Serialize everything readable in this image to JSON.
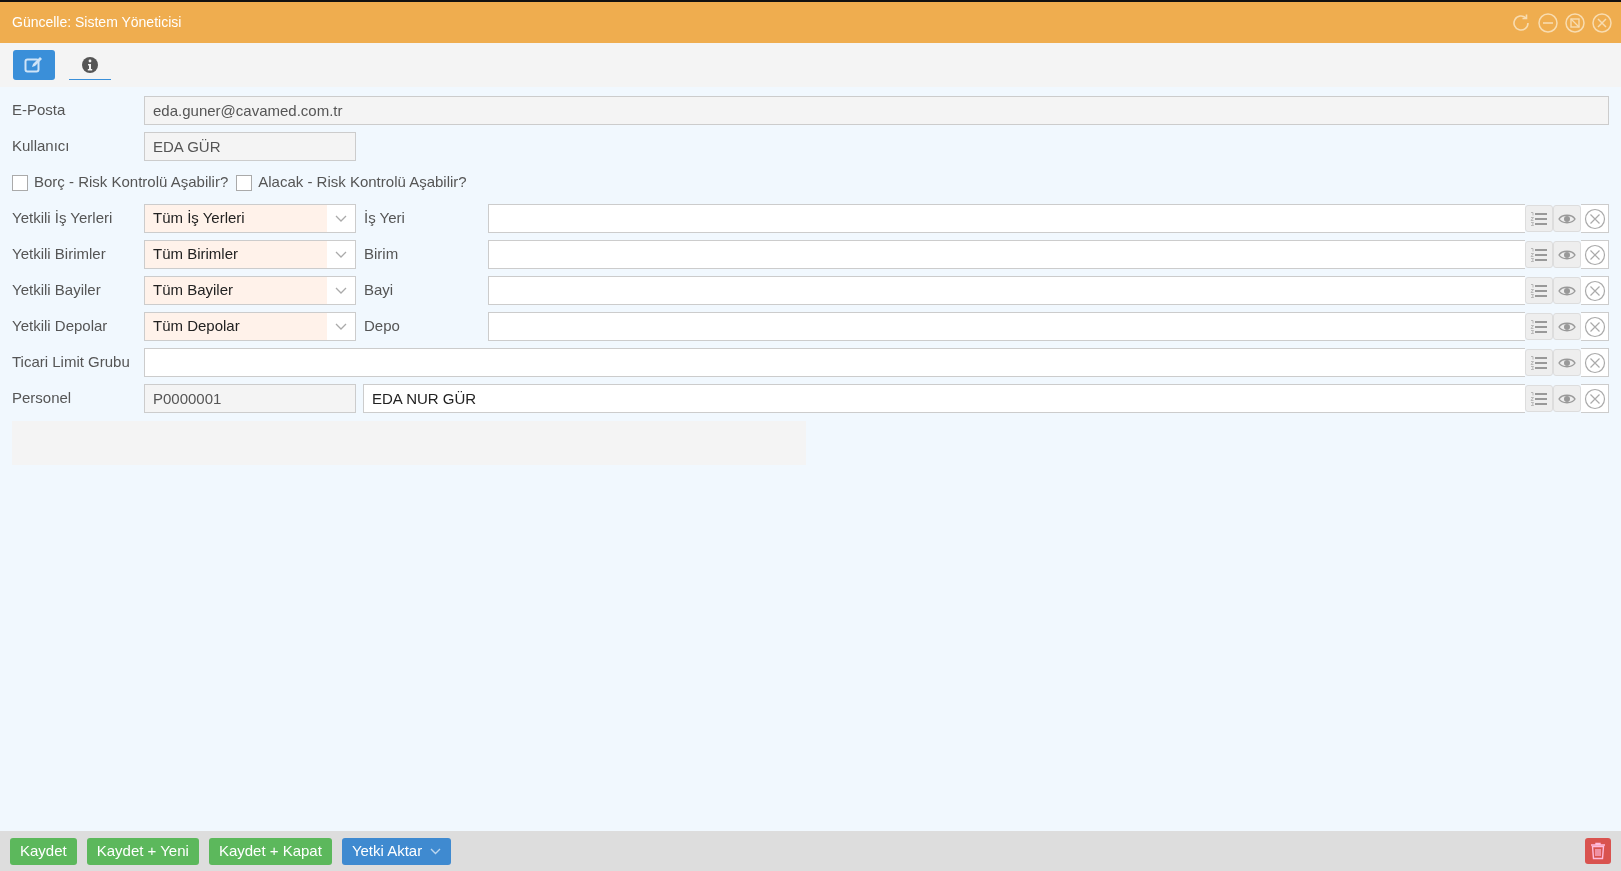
{
  "window": {
    "title": "Güncelle: Sistem Yöneticisi"
  },
  "tabs": [
    {
      "kind": "edit",
      "selected": true
    },
    {
      "kind": "info",
      "selected": false
    }
  ],
  "form_rows": [
    {
      "kind": "wide_text",
      "label": "E-Posta",
      "value": "eda.guner@cavamed.com.tr"
    },
    {
      "kind": "short_text",
      "label": "Kullanıcı",
      "value": "EDA GÜR"
    },
    {
      "kind": "checkboxes",
      "items": [
        {
          "label": "Borç - Risk Kontrolü Aşabilir?",
          "checked": false
        },
        {
          "label": "Alacak - Risk Kontrolü Aşabilir?",
          "checked": false
        }
      ]
    },
    {
      "kind": "dropdown_lookup",
      "label": "Yetkili İş Yerleri",
      "dropdown_value": "Tüm İş Yerleri",
      "lookup_label": "İş Yeri"
    },
    {
      "kind": "dropdown_lookup",
      "label": "Yetkili Birimler",
      "dropdown_value": "Tüm Birimler",
      "lookup_label": "Birim"
    },
    {
      "kind": "dropdown_lookup",
      "label": "Yetkili Bayiler",
      "dropdown_value": "Tüm Bayiler",
      "lookup_label": "Bayi"
    },
    {
      "kind": "dropdown_lookup",
      "label": "Yetkili Depolar",
      "dropdown_value": "Tüm Depolar",
      "lookup_label": "Depo"
    },
    {
      "kind": "mid_lookup",
      "label": "Ticari Limit Grubu"
    },
    {
      "kind": "code_lookup",
      "label": "Personel",
      "code": "P0000001",
      "lookup_value": "EDA NUR GÜR"
    }
  ],
  "footer": {
    "buttons": [
      {
        "label": "Kaydet",
        "kind": "success"
      },
      {
        "label": "Kaydet + Yeni",
        "kind": "success"
      },
      {
        "label": "Kaydet + Kapat",
        "kind": "success"
      },
      {
        "label": "Yetki Aktar",
        "kind": "dropdown"
      }
    ]
  }
}
